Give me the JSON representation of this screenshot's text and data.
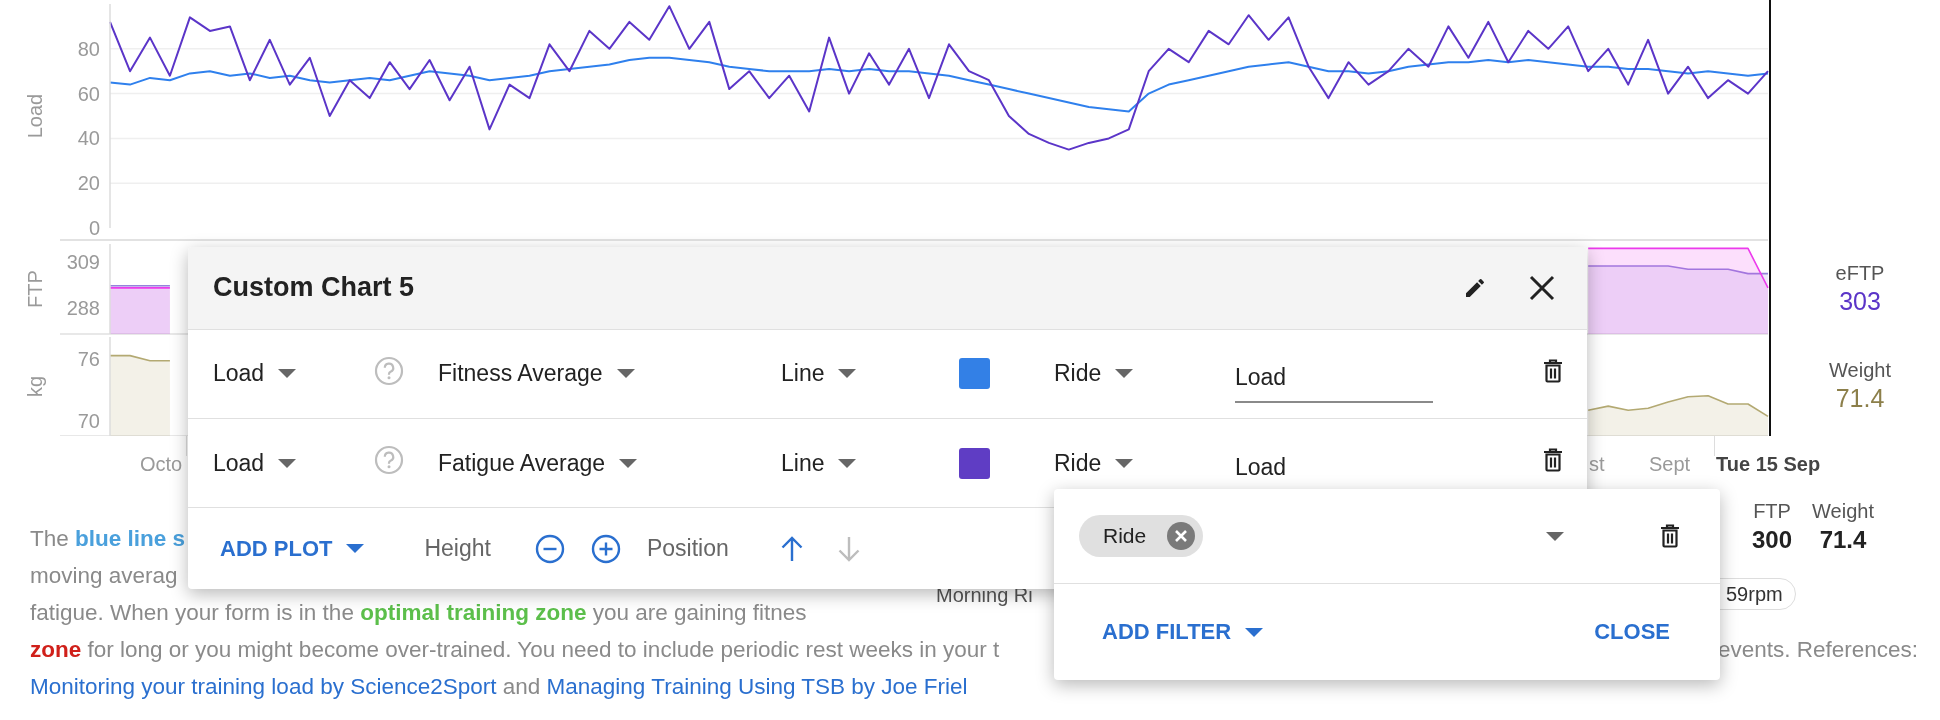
{
  "charts": [
    {
      "chart_data": {
        "type": "line",
        "ylabel": "Load",
        "ylim": [
          0,
          100
        ],
        "yticks": [
          0,
          20,
          40,
          60,
          80
        ],
        "grid": true,
        "series": [
          {
            "color": "#2f80ed",
            "values": [
              65,
              64,
              67,
              66,
              69,
              70,
              68,
              69,
              67,
              68,
              66,
              65,
              66,
              67,
              66,
              68,
              70,
              69,
              68,
              66,
              67,
              68,
              70,
              71,
              72,
              73,
              75,
              76,
              76,
              75,
              74,
              72,
              71,
              70,
              70,
              70,
              71,
              70,
              71,
              70,
              70,
              69,
              68,
              66,
              64,
              62,
              60,
              58,
              56,
              54,
              53,
              52,
              60,
              64,
              66,
              68,
              70,
              72,
              73,
              74,
              72,
              70,
              70,
              69,
              70,
              72,
              73,
              74,
              74,
              75,
              74,
              75,
              74,
              73,
              72,
              72,
              71,
              71,
              70,
              69,
              70,
              69,
              68,
              69
            ]
          },
          {
            "color": "#5b35c8",
            "values": [
              92,
              70,
              85,
              68,
              94,
              88,
              90,
              66,
              84,
              64,
              76,
              50,
              66,
              58,
              74,
              62,
              75,
              57,
              72,
              44,
              64,
              58,
              82,
              70,
              88,
              80,
              92,
              84,
              99,
              80,
              92,
              62,
              70,
              58,
              68,
              52,
              85,
              60,
              78,
              64,
              80,
              58,
              82,
              70,
              66,
              50,
              42,
              38,
              35,
              38,
              40,
              44,
              70,
              80,
              74,
              88,
              82,
              95,
              84,
              94,
              72,
              58,
              74,
              64,
              70,
              80,
              72,
              90,
              76,
              92,
              74,
              88,
              80,
              90,
              70,
              80,
              64,
              84,
              60,
              72,
              58,
              66,
              60,
              70
            ]
          }
        ]
      }
    },
    {
      "chart_data": {
        "type": "area",
        "ylabel": "FTP",
        "ylim": [
          276,
          317
        ],
        "yticks": [
          288,
          309
        ],
        "series": [
          {
            "color": "#9582dc",
            "values": [
              298,
              298,
              298,
              298,
              null,
              null,
              null,
              null,
              null,
              null,
              null,
              null,
              null,
              null,
              null,
              null,
              null,
              null,
              null,
              null,
              null,
              null,
              null,
              null,
              null,
              null,
              null,
              null,
              null,
              null,
              null,
              null,
              null,
              null,
              null,
              null,
              null,
              null,
              null,
              null,
              null,
              null,
              null,
              null,
              null,
              null,
              null,
              null,
              null,
              null,
              null,
              null,
              null,
              null,
              null,
              null,
              null,
              null,
              null,
              null,
              null,
              null,
              null,
              null,
              null,
              null,
              null,
              null,
              null,
              null,
              null,
              null,
              null,
              null,
              307,
              307,
              307,
              307,
              307,
              305.5,
              305.5,
              305.5,
              303.5,
              303.5
            ]
          },
          {
            "color": "#ec3bec",
            "values": [
              297,
              297,
              297,
              297,
              null,
              null,
              null,
              null,
              null,
              null,
              null,
              null,
              null,
              null,
              null,
              null,
              null,
              null,
              null,
              null,
              null,
              null,
              null,
              null,
              null,
              null,
              null,
              null,
              null,
              null,
              null,
              null,
              null,
              null,
              null,
              null,
              null,
              null,
              null,
              null,
              null,
              null,
              null,
              null,
              null,
              null,
              null,
              null,
              null,
              null,
              null,
              null,
              null,
              null,
              null,
              null,
              null,
              null,
              null,
              null,
              null,
              null,
              null,
              null,
              null,
              null,
              null,
              null,
              null,
              null,
              null,
              null,
              null,
              null,
              315,
              315,
              315,
              315,
              315,
              315,
              315,
              315,
              315,
              297
            ]
          }
        ]
      },
      "side": {
        "label": "eFTP",
        "value": "303",
        "color": "#5b35c8"
      }
    },
    {
      "chart_data": {
        "type": "area",
        "ylabel": "kg",
        "ylim": [
          68.5,
          78.1
        ],
        "yticks": [
          70,
          76
        ],
        "series": [
          {
            "color": "#b3a972",
            "values": [
              76.3,
              76.3,
              75.8,
              75.8,
              null,
              null,
              null,
              null,
              null,
              null,
              null,
              null,
              null,
              null,
              null,
              null,
              null,
              null,
              null,
              null,
              null,
              null,
              null,
              null,
              null,
              null,
              null,
              null,
              null,
              null,
              null,
              null,
              null,
              null,
              null,
              null,
              null,
              null,
              null,
              null,
              null,
              null,
              null,
              null,
              null,
              null,
              null,
              null,
              null,
              null,
              null,
              null,
              null,
              null,
              null,
              null,
              null,
              null,
              null,
              null,
              null,
              null,
              null,
              null,
              null,
              null,
              null,
              null,
              null,
              null,
              null,
              null,
              null,
              null,
              71.0,
              71.4,
              71.0,
              71.2,
              71.8,
              72.3,
              72.4,
              71.6,
              71.6,
              70.4
            ]
          }
        ]
      },
      "side": {
        "label": "Weight",
        "value": "71.4",
        "color": "#8c7f4a"
      }
    }
  ],
  "timeline": [
    {
      "label": "Octo",
      "kind": "month"
    },
    {
      "label": "st",
      "kind": "month"
    },
    {
      "label": "Sept",
      "kind": "month"
    },
    {
      "label": "Tue 15 Sep",
      "kind": "current"
    }
  ],
  "description_lines": [
    [
      {
        "text": "The ",
        "kind": "plain"
      },
      {
        "text": "blue line s",
        "kind": "blue"
      }
    ],
    [
      {
        "text": "moving averag",
        "kind": "plain"
      }
    ],
    [
      {
        "text": "fatigue. When your form is in the ",
        "kind": "plain"
      },
      {
        "text": "optimal training zone",
        "kind": "green"
      },
      {
        "text": " you are gaining fitnes",
        "kind": "plain"
      }
    ],
    [
      {
        "text": "zone",
        "kind": "red"
      },
      {
        "text": " for long or you might become over-trained. You need to include periodic rest weeks in your t",
        "kind": "plain"
      }
    ],
    [
      {
        "text": "Monitoring your training load by Science2Sport",
        "kind": "link"
      },
      {
        "text": " and ",
        "kind": "plain"
      },
      {
        "text": "Managing Training Using TSB by Joe Friel",
        "kind": "link"
      }
    ]
  ],
  "description_tail": "events. References:",
  "activity": {
    "name": "Morning Ri",
    "stats": [
      {
        "label": "FTP",
        "value": "300"
      },
      {
        "label": "Weight",
        "value": "71.4"
      }
    ],
    "cadence": "59rpm"
  },
  "custom_chart_dialog": {
    "title": "Custom Chart 5",
    "plots": [
      {
        "metric": "Load",
        "field": "Fitness Average",
        "style": "Line",
        "color": "#3380e6",
        "activity": "Ride",
        "label": "Load",
        "focused": true
      },
      {
        "metric": "Load",
        "field": "Fatigue Average",
        "style": "Line",
        "color": "#5f3dc4",
        "activity": "Ride",
        "label": "Load"
      }
    ],
    "add_plot": "ADD PLOT",
    "height_label": "Height",
    "height_buttons": [
      {
        "kind": "decrease",
        "disabled": false
      },
      {
        "kind": "increase",
        "disabled": false
      }
    ],
    "position_label": "Position",
    "position_buttons": [
      {
        "kind": "up",
        "disabled": false
      },
      {
        "kind": "down",
        "disabled": true
      }
    ]
  },
  "filter_popup": {
    "chips": [
      {
        "label": "Ride"
      }
    ],
    "add_filter": "ADD FILTER",
    "close": "CLOSE"
  }
}
